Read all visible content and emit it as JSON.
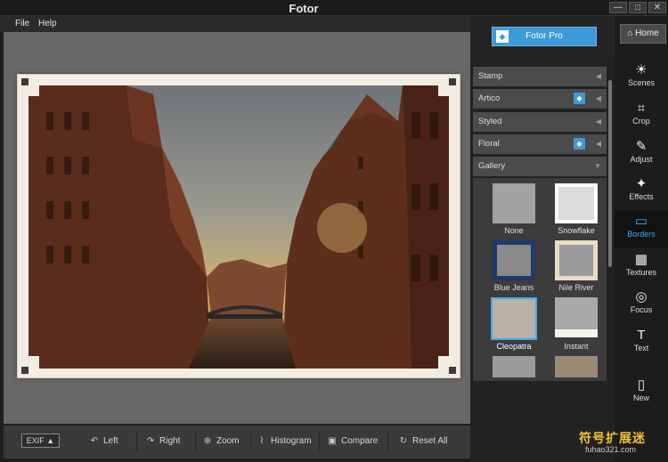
{
  "app": {
    "title": "Fotor"
  },
  "window_controls": {
    "minimize": "—",
    "maximize": "□",
    "close": "✕"
  },
  "menu": [
    "File",
    "Help"
  ],
  "pro": {
    "label": "Fotor Pro"
  },
  "home": {
    "label": "Home"
  },
  "categories": [
    {
      "label": "Stamp",
      "pro": false
    },
    {
      "label": "Artico",
      "pro": true
    },
    {
      "label": "Styled",
      "pro": false
    },
    {
      "label": "Floral",
      "pro": true
    },
    {
      "label": "Gallery",
      "pro": false
    }
  ],
  "gallery_thumbs": [
    "None",
    "Snowflake",
    "Blue Jeans",
    "Nile River",
    "Cleopatra",
    "Instant"
  ],
  "sidebar": [
    {
      "label": "Scenes",
      "icon": "☀"
    },
    {
      "label": "Crop",
      "icon": "⌗"
    },
    {
      "label": "Adjust",
      "icon": "✎"
    },
    {
      "label": "Effects",
      "icon": "✦"
    },
    {
      "label": "Borders",
      "icon": "▭",
      "active": true
    },
    {
      "label": "Textures",
      "icon": "▦"
    },
    {
      "label": "Focus",
      "icon": "◎"
    },
    {
      "label": "Text",
      "icon": "T"
    },
    {
      "label": "New",
      "icon": "▯"
    }
  ],
  "toolbar": {
    "exif": "EXIF ▲",
    "left": "Left",
    "right": "Right",
    "zoom": "Zoom",
    "histogram": "Histogram",
    "compare": "Compare",
    "reset": "Reset All"
  },
  "watermark": {
    "main": "符号扩展迷",
    "url": "fuhao321.com"
  }
}
